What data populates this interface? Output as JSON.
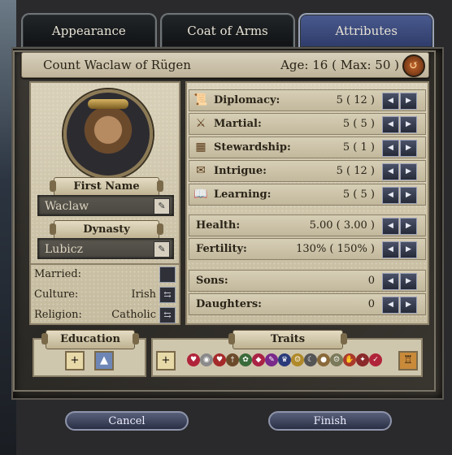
{
  "tabs": [
    {
      "label": "Appearance",
      "active": false
    },
    {
      "label": "Coat of Arms",
      "active": false
    },
    {
      "label": "Attributes",
      "active": true
    }
  ],
  "header": {
    "title": "Count Waclaw of Rügen",
    "age": "Age: 16 ( Max: 50 )",
    "back_icon": "back-arrow-icon"
  },
  "character": {
    "first_name_label": "First Name",
    "first_name": "Waclaw",
    "dynasty_label": "Dynasty",
    "dynasty": "Lubicz"
  },
  "info": [
    {
      "label": "Married:",
      "value": ""
    },
    {
      "label": "Culture:",
      "value": "Irish"
    },
    {
      "label": "Religion:",
      "value": "Catholic"
    }
  ],
  "attributes": [
    {
      "icon": "diplomacy-icon",
      "label": "Diplomacy:",
      "value": "5 ( 12 )"
    },
    {
      "icon": "martial-icon",
      "label": "Martial:",
      "value": "5 ( 5 )"
    },
    {
      "icon": "stewardship-icon",
      "label": "Stewardship:",
      "value": "5 ( 1 )"
    },
    {
      "icon": "intrigue-icon",
      "label": "Intrigue:",
      "value": "5 ( 12 )"
    },
    {
      "icon": "learning-icon",
      "label": "Learning:",
      "value": "5 ( 5 )"
    }
  ],
  "stats": [
    {
      "label": "Health:",
      "value": "5.00 ( 3.00 )"
    },
    {
      "label": "Fertility:",
      "value": "130% ( 150% )"
    }
  ],
  "children": [
    {
      "label": "Sons:",
      "value": "0"
    },
    {
      "label": "Daughters:",
      "value": "0"
    }
  ],
  "education": {
    "label": "Education"
  },
  "traits": {
    "label": "Traits"
  },
  "buttons": {
    "cancel": "Cancel",
    "finish": "Finish"
  },
  "colors": {
    "tab_active": "#3e4d80",
    "parchment": "#cfc6ae",
    "button": "#3a4058"
  }
}
